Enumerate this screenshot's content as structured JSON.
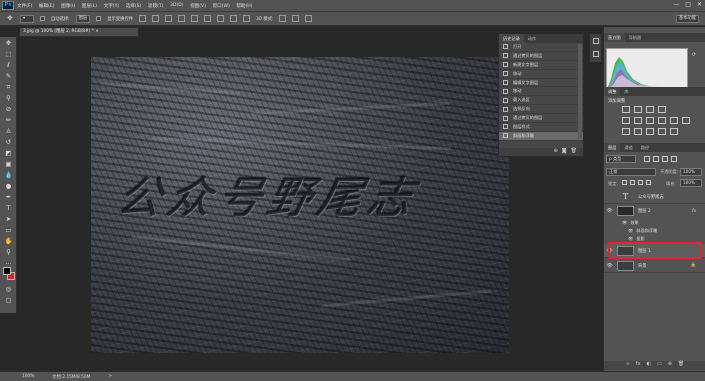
{
  "app": {
    "logo": "Ps"
  },
  "menu": [
    "文件(F)",
    "编辑(E)",
    "图像(I)",
    "图层(L)",
    "文字(Y)",
    "选择(S)",
    "滤镜(T)",
    "3D(D)",
    "视图(V)",
    "窗口(W)",
    "帮助(H)"
  ],
  "window_controls": {
    "minimize": "—",
    "maximize": "□",
    "close": "✕"
  },
  "options": {
    "auto_select_label": "自动选择:",
    "auto_select_value": "图层",
    "show_transform_label": "显示变换控件",
    "mode_3d": "3D 模式:",
    "workspace": "基本功能"
  },
  "document_tab": "3.jpg @ 100% (图层 2, RGB/8#) *  ×",
  "canvas": {
    "art_text": "公众号野尾志"
  },
  "status": {
    "zoom": "100%",
    "doc_size": "文档:2.15M/8.50M",
    "arrow": ">"
  },
  "history": {
    "tabs": [
      "历史记录",
      "动作"
    ],
    "items": [
      "打开",
      "通过拷贝的图层",
      "新建文字图层",
      "移动",
      "编辑文字图层",
      "移动",
      "载入选区",
      "选择反向",
      "通过拷贝的图层",
      "图层样式",
      "斜面和浮雕"
    ],
    "selected_index": 10,
    "footer_icons": [
      "⊕",
      "◙",
      "🗑"
    ]
  },
  "right_panels": {
    "top_tabs": [
      "直方图",
      "导航器"
    ],
    "adjust_tabs": [
      "调整",
      "库"
    ],
    "adjust_title": "添加调整",
    "layers_tabs": [
      "图层",
      "通道",
      "路径"
    ],
    "kind_filter": "ρ 类型",
    "blend_mode": "正常",
    "opacity_label": "不透明度:",
    "opacity_value": "100%",
    "lock_label": "锁定:",
    "fill_label": "填充:",
    "fill_value": "100%",
    "layers": [
      {
        "name": "公众号野尾志",
        "type": "text"
      },
      {
        "name": "图层 2",
        "fx": "fx",
        "effects_label": "效果",
        "effects": [
          "斜面和浮雕",
          "投影"
        ]
      },
      {
        "name": "图层 1",
        "highlighted": true
      },
      {
        "name": "背景",
        "locked": true
      }
    ],
    "footer_icons": [
      "∞",
      "fx",
      "◐",
      "▭",
      "⊕",
      "🗑"
    ]
  },
  "colors": {
    "highlight_box": "#e3262d",
    "ps_blue": "#2e9bd6"
  }
}
